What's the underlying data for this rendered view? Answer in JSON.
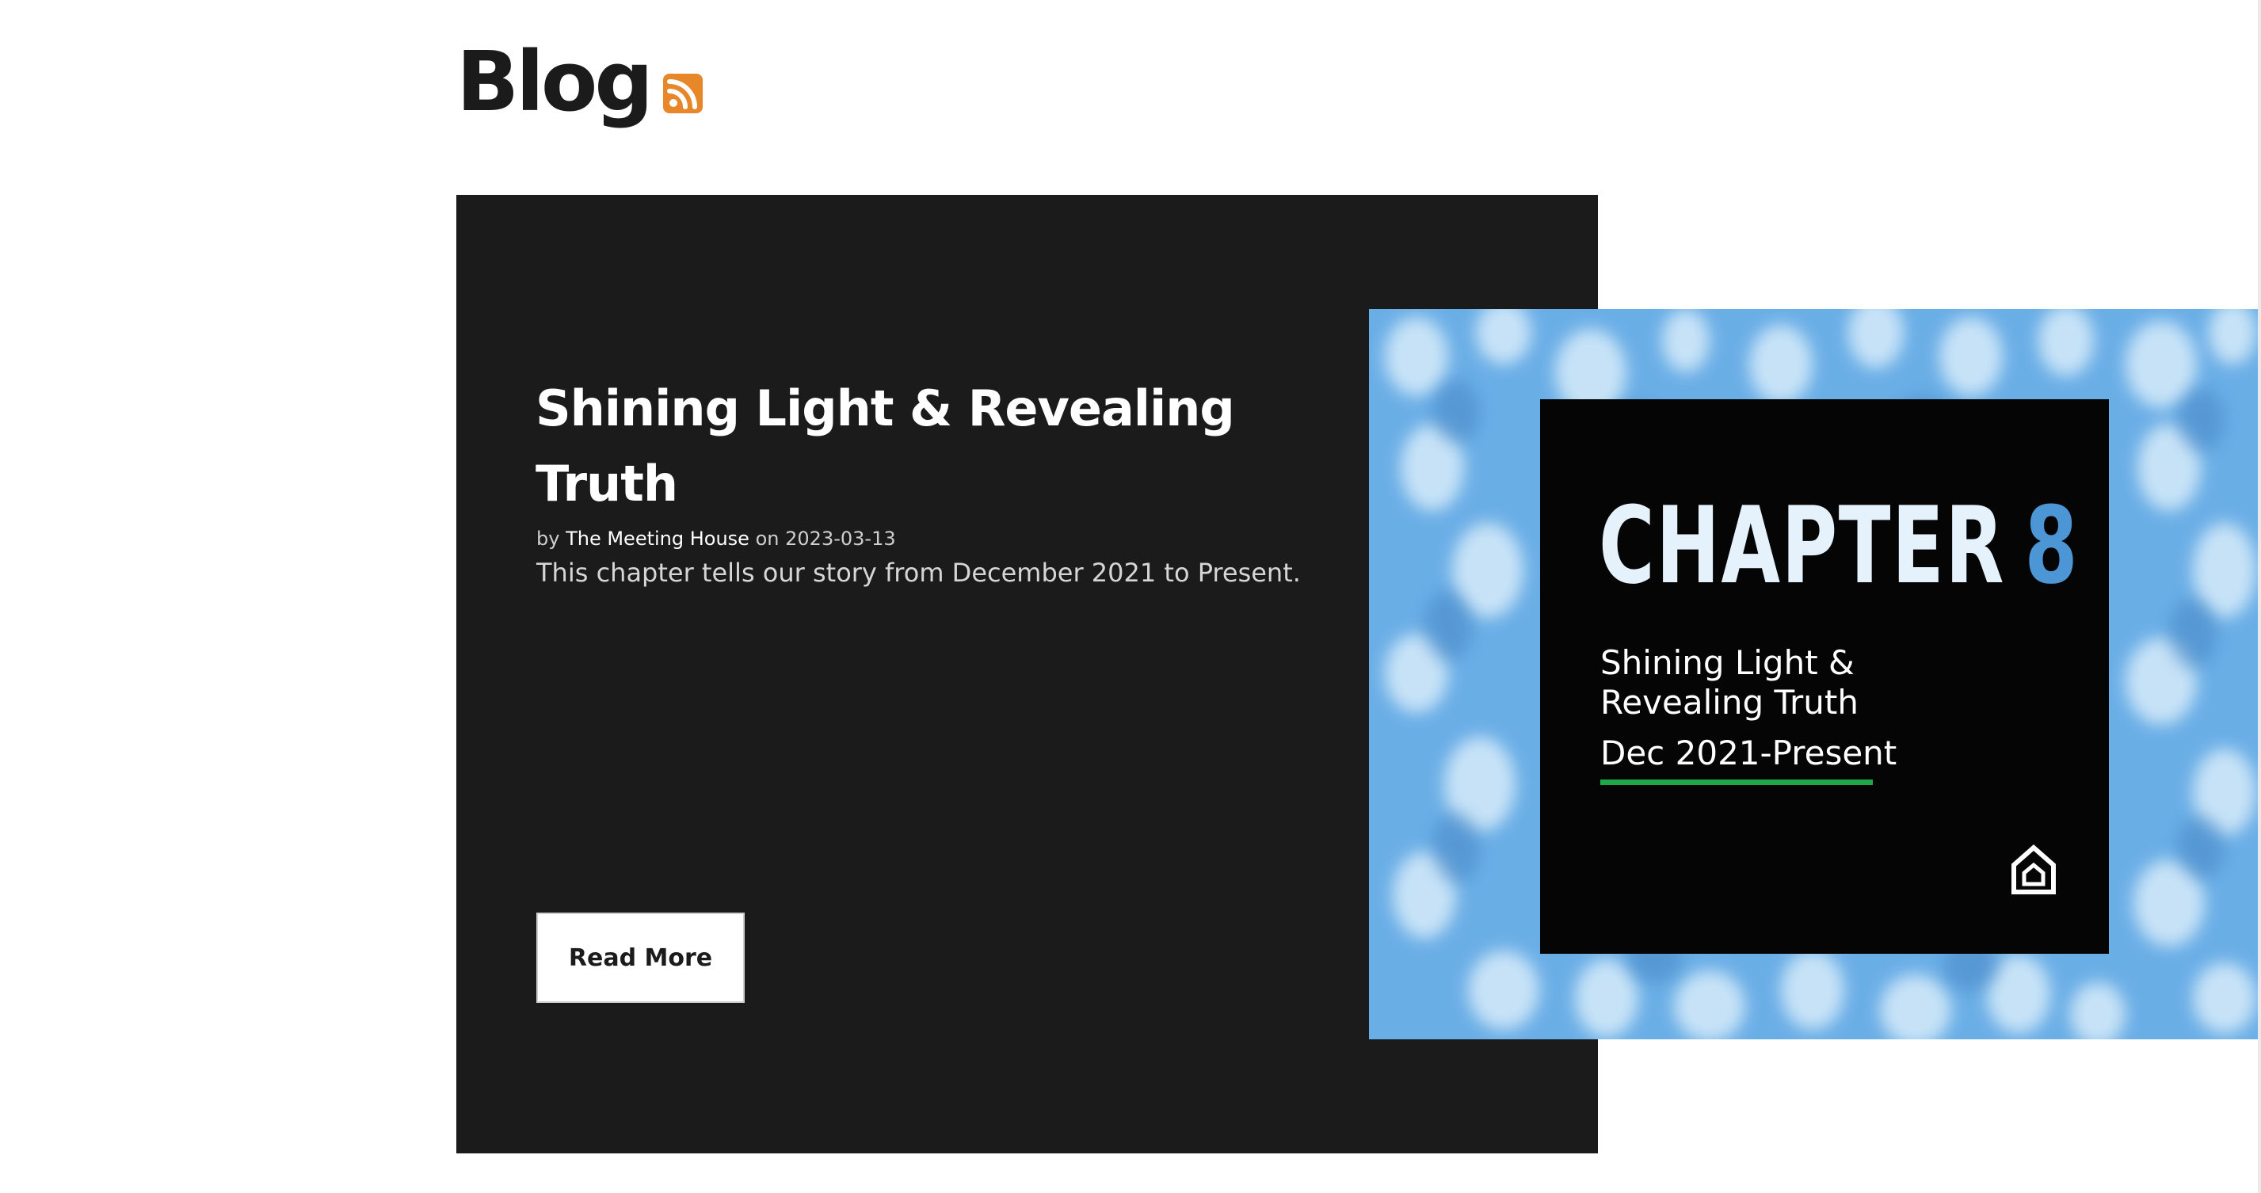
{
  "header": {
    "title": "Blog",
    "rss_icon": "rss-feed-icon"
  },
  "post": {
    "title": "Shining Light & Revealing Truth",
    "meta_by": "by",
    "author": "The Meeting House",
    "meta_on": "on",
    "date": "2023-03-13",
    "excerpt": "This chapter tells our story from December 2021 to Present.",
    "read_more_label": "Read More"
  },
  "feature_image": {
    "chapter_word": "CHAPTER",
    "chapter_number": "8",
    "subtitle_line1": "Shining Light &",
    "subtitle_line2": "Revealing Truth",
    "dates": "Dec 2021-Present",
    "logo_icon": "house-logo-icon"
  },
  "colors": {
    "card_background": "#1b1b1b",
    "rss_orange": "#e8862a",
    "image_blue": "#6aaee6",
    "chapter_number_blue": "#4d96d6",
    "underline_green": "#1fa84a"
  }
}
